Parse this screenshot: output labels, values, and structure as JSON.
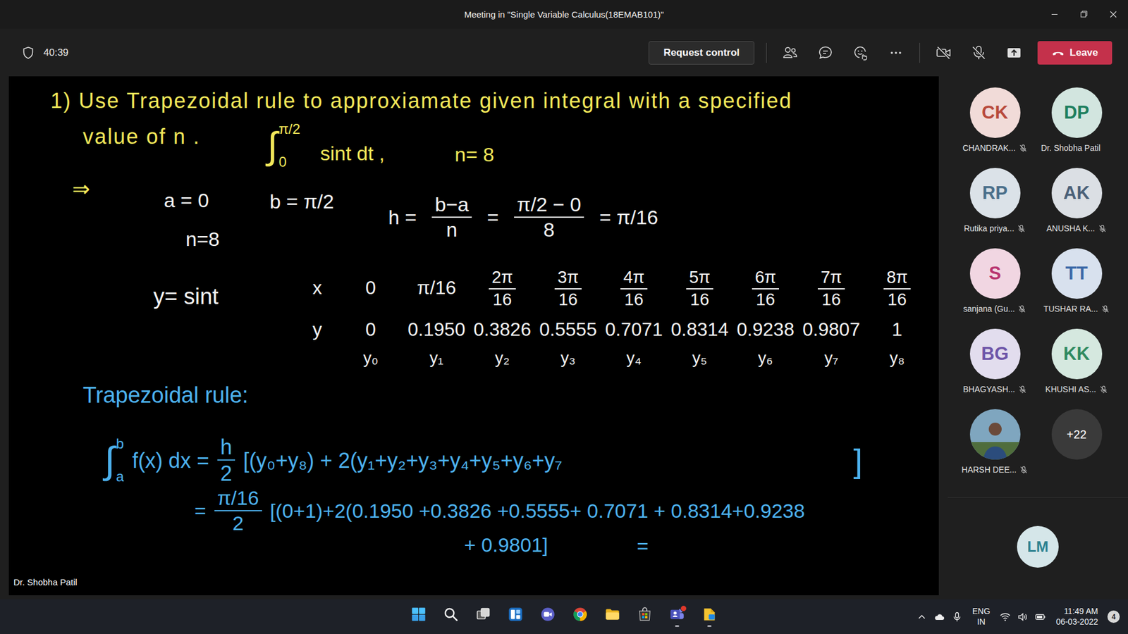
{
  "window": {
    "title": "Meeting in \"Single Variable Calculus(18EMAB101)\""
  },
  "toolbar": {
    "timer": "40:39",
    "request_control": "Request control",
    "leave": "Leave",
    "camera_on": false,
    "mic_on": false
  },
  "shared_screen": {
    "presenter": "Dr. Shobha Patil",
    "question": {
      "line1": "1) Use Trapezoidal rule to approxiamate given integral with a specified",
      "line2": "value of n .",
      "integral": {
        "symbol": "∫",
        "upper": "π/2",
        "lower": "0"
      },
      "integrand": "sint dt ,",
      "n": "n= 8"
    },
    "given": {
      "arrow": "⇒",
      "a": "a = 0",
      "b": "b = π/2",
      "n": "n=8",
      "h": {
        "lhs": "h =",
        "frac1": {
          "num": "b−a",
          "den": "n"
        },
        "eq": "=",
        "frac2": {
          "num": "π/2 − 0",
          "den": "8"
        },
        "result": "= π/16"
      }
    },
    "table": {
      "function": "y= sint",
      "x_label": "x",
      "y_label": "y",
      "x": [
        {
          "kind": "plain",
          "text": "0"
        },
        {
          "kind": "plain",
          "text": "π/16"
        },
        {
          "kind": "fraction",
          "num": "2π",
          "den": "16"
        },
        {
          "kind": "fraction",
          "num": "3π",
          "den": "16"
        },
        {
          "kind": "fraction",
          "num": "4π",
          "den": "16"
        },
        {
          "kind": "fraction",
          "num": "5π",
          "den": "16"
        },
        {
          "kind": "fraction",
          "num": "6π",
          "den": "16"
        },
        {
          "kind": "fraction",
          "num": "7π",
          "den": "16"
        },
        {
          "kind": "fraction",
          "num": "8π",
          "den": "16"
        }
      ],
      "y": [
        "0",
        "0.1950",
        "0.3826",
        "0.5555",
        "0.7071",
        "0.8314",
        "0.9238",
        "0.9807",
        "1"
      ],
      "labels": [
        "y₀",
        "y₁",
        "y₂",
        "y₃",
        "y₄",
        "y₅",
        "y₆",
        "y₇",
        "y₈"
      ]
    },
    "rule": {
      "title": "Trapezoidal rule:",
      "line1": {
        "integral": {
          "symbol": "∫",
          "upper": "b",
          "lower": "a"
        },
        "lhs": "f(x) dx =",
        "frac": {
          "num": "h",
          "den": "2"
        },
        "body": "[(y₀+y₈) + 2(y₁+y₂+y₃+y₄+y₅+y₆+y₇",
        "close": "]"
      },
      "line2": {
        "eq": "=",
        "frac": {
          "num": "π/16",
          "den": "2"
        },
        "body": "[(0+1)+2(0.1950 +0.3826 +0.5555+ 0.7071 + 0.8314+0.9238"
      },
      "line3": {
        "body": "+ 0.9801]",
        "eq": "="
      }
    }
  },
  "participants": [
    {
      "kind": "initials",
      "initials": "CK",
      "name": "CHANDRAK...",
      "muted": true,
      "color": "#b84a3c"
    },
    {
      "kind": "initials",
      "initials": "DP",
      "name": "Dr. Shobha Patil",
      "muted": false,
      "color": "#1e7f5e"
    },
    {
      "kind": "initials",
      "initials": "RP",
      "name": "Rutika priya...",
      "muted": true,
      "color": "#4a6f8a"
    },
    {
      "kind": "initials",
      "initials": "AK",
      "name": "ANUSHA K...",
      "muted": true,
      "color": "#4a6078"
    },
    {
      "kind": "initials",
      "initials": "S",
      "name": "sanjana (Gu...",
      "muted": true,
      "color": "#b8336f"
    },
    {
      "kind": "initials",
      "initials": "TT",
      "name": "TUSHAR RA...",
      "muted": true,
      "color": "#3d6aa8"
    },
    {
      "kind": "initials",
      "initials": "BG",
      "name": "BHAGYASH...",
      "muted": true,
      "color": "#6d55a8"
    },
    {
      "kind": "initials",
      "initials": "KK",
      "name": "KHUSHI AS...",
      "muted": true,
      "color": "#2f8a60"
    },
    {
      "kind": "photo",
      "name": "HARSH DEE...",
      "muted": true
    }
  ],
  "panel": {
    "more": "+22",
    "self": {
      "initials": "LM",
      "color": "#2d8290"
    }
  },
  "taskbar": {
    "apps": [
      {
        "kind": "start",
        "running": false,
        "notification": false
      },
      {
        "kind": "search",
        "running": false,
        "notification": false
      },
      {
        "kind": "taskview",
        "running": false,
        "notification": false
      },
      {
        "kind": "widgets",
        "running": false,
        "notification": false
      },
      {
        "kind": "meet",
        "running": false,
        "notification": false
      },
      {
        "kind": "chrome",
        "running": false,
        "notification": false
      },
      {
        "kind": "explorer",
        "running": false,
        "notification": false
      },
      {
        "kind": "store",
        "running": false,
        "notification": false
      },
      {
        "kind": "teams",
        "running": true,
        "notification": true
      },
      {
        "kind": "files",
        "running": true,
        "notification": false
      }
    ],
    "tray": {
      "language": "ENG",
      "region": "IN",
      "time": "11:49 AM",
      "date": "06-03-2022",
      "notifications": "4"
    }
  }
}
